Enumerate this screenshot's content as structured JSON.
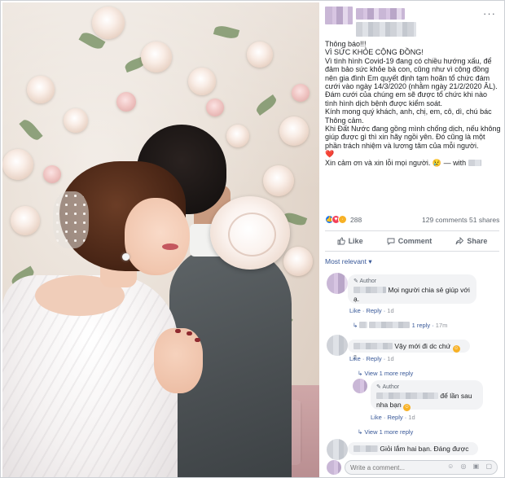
{
  "post": {
    "more_label": "···",
    "body_lines": [
      "Thông báo!!!",
      "VÌ SỨC KHỎE CỘNG ĐỒNG!",
      "Vì tình hình Covid-19 đang có chiều hướng xấu, để đảm bảo sức khỏe bà con, cũng như vì cộng đồng nên gia đình Em quyết định tạm hoãn tổ chức đám cưới vào ngày 14/3/2020 (nhằm ngày 21/2/2020 ÂL). Đám cưới của chúng em sẽ được tổ chức khi nào tình hình dịch bệnh được kiểm soát.",
      "Kính mong quý khách, anh, chị, em, cô, dì, chú bác Thông cảm.",
      "Khi Đất Nước đang gồng mình chống dịch, nếu không giúp được gì thì xin hãy ngồi yên. Đó cũng là một phần trách nhiệm và lương tâm của mỗi người."
    ],
    "heart": "❤️",
    "closing": "Xin cảm ơn và xin lỗi mọi người.",
    "closing_emoji": "😢",
    "with_label": "— with"
  },
  "reactions": {
    "count": "288",
    "comments": "129 comments",
    "shares": "51 shares"
  },
  "actions": {
    "like": "Like",
    "comment": "Comment",
    "share": "Share"
  },
  "sort_label": "Most relevant",
  "comments": [
    {
      "author_tag": "Author",
      "text": "Mọi người chia sẻ giúp với ạ.",
      "like": "Like",
      "reply": "Reply",
      "time": "1d"
    },
    {
      "reply_summary": "1 reply",
      "reply_time": "17m"
    },
    {
      "text": "Vậy mới đi dc chứ",
      "reaction_count": "2",
      "like": "Like",
      "reply": "Reply",
      "time": "1d",
      "more_replies": "View 1 more reply"
    },
    {
      "author_tag": "Author",
      "text": "để lần sau nha bạn",
      "like": "Like",
      "reply": "Reply",
      "time": "1d",
      "more_replies": "View 1 more reply"
    },
    {
      "text": "Giỏi lắm hai bạn. Đáng được"
    }
  ],
  "composer": {
    "placeholder": "Write a comment...",
    "icons": "☺ ◎ ▣ ▢"
  },
  "colors": {
    "link": "#385898",
    "like_blue": "#1877f2",
    "love_red": "#f33e58",
    "sad_yellow": "#f7b125",
    "bubble": "#f2f3f5"
  }
}
